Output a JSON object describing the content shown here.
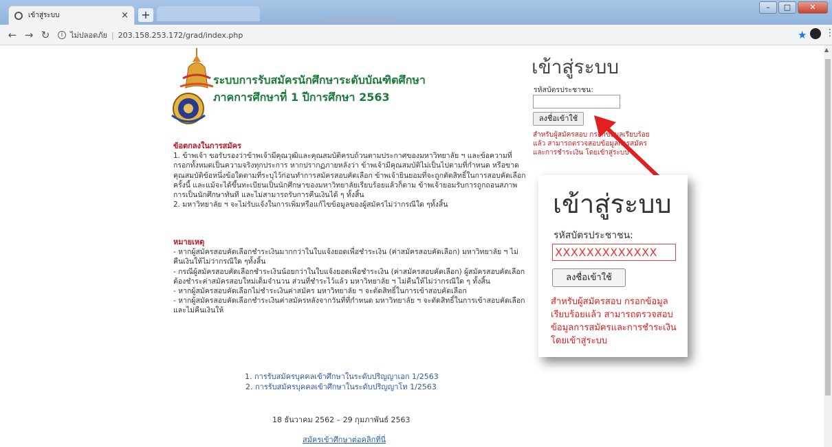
{
  "browser": {
    "tab_title": "เข้าสู่ระบบ",
    "url_security": "ไม่ปลอดภัย",
    "url": "203.158.253.172/grad/index.php"
  },
  "site": {
    "title_line1": "ระบบการรับสมัครนักศึกษาระดับบัณฑิตศึกษา",
    "title_line2": "ภาคการศึกษาที่ 1 ปีการศึกษา 2563"
  },
  "terms": {
    "heading": "ข้อตกลงในการสมัคร",
    "items": [
      "1. ข้าพเจ้า ขอรับรองว่าข้าพเจ้ามีคุณวุฒิและคุณสมบัติครบถ้วนตามประกาศของมหาวิทยาลัย ฯ และข้อความที่กรอกทั้งหมดเป็นความจริงทุกประการ หากปรากฏภายหลังว่า ข้าพเจ้ามีคุณสมบัติไม่เป็นไปตามที่กำหนด หรือขาดคุณสมบัติข้อหนึ่งข้อใดตามที่ระบุไว้ก่อนทำการสมัครสอบคัดเลือก ข้าพเจ้ายินยอมที่จะถูกตัดสิทธิ์ในการสอบคัดเลือกครั้งนี้ และแม้จะได้ขึ้นทะเบียนเป็นนักศึกษาของมหาวิทยาลัยเรียบร้อยแล้วก็ตาม ข้าพเจ้ายอมรับการถูกถอนสภาพการเป็นนักศึกษาทันที และไม่สามารถรับการคืนเงินได้ ๆ ทั้งสิ้น",
      "2. มหาวิทยาลัย ฯ จะไม่รับแจ้งในการเพิ่มหรือแก้ไขข้อมูลของผู้สมัครไม่ว่ากรณีใด ๆทั้งสิ้น"
    ]
  },
  "notes": {
    "heading": "หมายเหตุ",
    "items": [
      "- หากผู้สมัครสอบคัดเลือกชำระเงินมากกว่าในใบแจ้งยอดเพื่อชำระเงิน (ค่าสมัครสอบคัดเลือก) มหาวิทยาลัย ฯ ไม่คืนเงินให้ไม่ว่ากรณีใด ๆทั้งสิ้น",
      "- กรณีผู้สมัครสอบคัดเลือกชำระเงินน้อยกว่าในใบแจ้งยอดเพื่อชำระเงิน (ค่าสมัครสอบคัดเลือก) ผู้สมัครสอบคัดเลือกต้องชำระค่าสมัครสอบใหม่เต็มจำนวน ส่วนที่ชำระไว้แล้ว มหาวิทยาลัย ฯ ไม่คืนให้ไม่ว่ากรณีใด ๆ ทั้งสิ้น",
      "- หากผู้สมัครสอบคัดเลือกไม่ชำระเงินค่าสมัคร มหาวิทยาลัย ฯ จะตัดสิทธิ์ในการเข้าสอบคัดเลือก",
      "- หากผู้สมัครสอบคัดเลือกชำระเงินค่าสมัครหลังจากวันที่ที่กำหนด มหาวิทยาลัย ฯ จะตัดสิทธิ์ในการเข้าสอบคัดเลือกและไม่คืนเงินให้"
    ]
  },
  "programs": [
    {
      "num": "1.",
      "label": "การรับสมัครบุคคลเข้าศึกษาในระดับปริญญาเอก 1/2563"
    },
    {
      "num": "2.",
      "label": "การรับสมัครบุคคลเข้าศึกษาในระดับปริญญาโท 1/2563"
    }
  ],
  "date_range": "18 ธันวาคม 2562 – 29 กุมภาพันธ์ 2563",
  "apply_link": "สมัครเข้าศึกษาต่อคลิกที่นี่",
  "login": {
    "title": "เข้าสู่ระบบ",
    "id_label": "รหัสบัตรประชาชน:",
    "id_value": "",
    "button": "ลงชื่อเข้าใช้",
    "note": "สำหรับผู้สมัครสอบ กรอกข้อมูลเรียบร้อยแล้ว สามารถตรวจสอบข้อมูลการสมัครและการชำระเงิน โดยเข้าสู่ระบบ"
  },
  "callout": {
    "title": "เข้าสู่ระบบ",
    "id_label": "รหัสบัตรประชาชน:",
    "id_value": "XXXXXXXXXXXXX",
    "button": "ลงชื่อเข้าใช้",
    "note_line1": "สำหรับผู้สมัครสอบ กรอกข้อมูล",
    "note_line2": "เรียบร้อยแล้ว สามารถตรวจสอบ",
    "note_line3": "ข้อมูลการสมัครและการชำระเงิน",
    "note_line4": "โดยเข้าสู่ระบบ"
  },
  "colors": {
    "title_green": "#1c7a3a",
    "heading_red": "#c1121f",
    "link_blue": "#2c5aa0",
    "arrow_red": "#e02020"
  }
}
